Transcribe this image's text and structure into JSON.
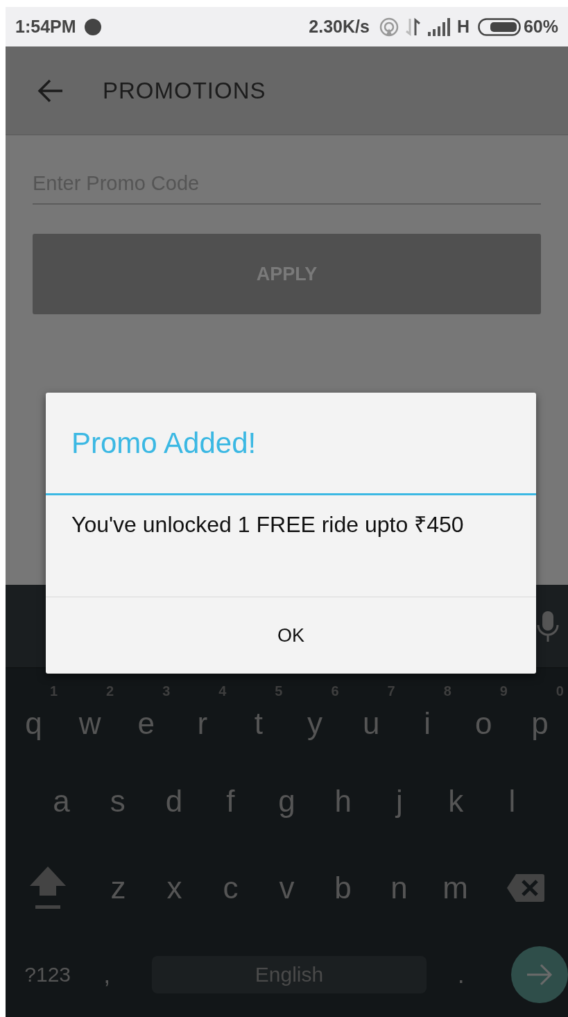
{
  "status_bar": {
    "time": "1:54PM",
    "speed": "2.30K/s",
    "network": "H",
    "battery": "60%"
  },
  "app_bar": {
    "title": "PROMOTIONS"
  },
  "promo_field": {
    "placeholder": "Enter Promo Code"
  },
  "apply_button": {
    "label": "APPLY",
    "disabled": true
  },
  "dialog": {
    "title": "Promo Added!",
    "message": "You've unlocked 1 FREE ride upto ₹450",
    "button": "OK"
  },
  "keyboard": {
    "rows": [
      [
        {
          "key": "q",
          "hint": "1"
        },
        {
          "key": "w",
          "hint": "2"
        },
        {
          "key": "e",
          "hint": "3"
        },
        {
          "key": "r",
          "hint": "4"
        },
        {
          "key": "t",
          "hint": "5"
        },
        {
          "key": "y",
          "hint": "6"
        },
        {
          "key": "u",
          "hint": "7"
        },
        {
          "key": "i",
          "hint": "8"
        },
        {
          "key": "o",
          "hint": "9"
        },
        {
          "key": "p",
          "hint": "0"
        }
      ],
      [
        {
          "key": "a"
        },
        {
          "key": "s"
        },
        {
          "key": "d"
        },
        {
          "key": "f"
        },
        {
          "key": "g"
        },
        {
          "key": "h"
        },
        {
          "key": "j"
        },
        {
          "key": "k"
        },
        {
          "key": "l"
        }
      ],
      [
        {
          "key": "z"
        },
        {
          "key": "x"
        },
        {
          "key": "c"
        },
        {
          "key": "v"
        },
        {
          "key": "b"
        },
        {
          "key": "n"
        },
        {
          "key": "m"
        }
      ]
    ],
    "symbols_key": "?123",
    "comma_key": ",",
    "space_label": "English",
    "period_key": "."
  }
}
